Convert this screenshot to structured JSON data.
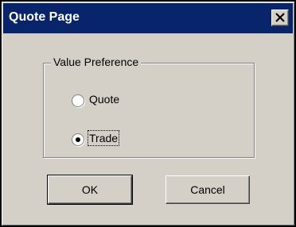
{
  "window": {
    "title": "Quote Page",
    "close_icon": "close-icon"
  },
  "group": {
    "legend": "Value Preference",
    "options": [
      {
        "label": "Quote",
        "selected": false
      },
      {
        "label": "Trade",
        "selected": true
      }
    ]
  },
  "buttons": {
    "ok_label": "OK",
    "cancel_label": "Cancel"
  },
  "colors": {
    "titlebar": "#08246b",
    "face": "#d4d0c8"
  }
}
